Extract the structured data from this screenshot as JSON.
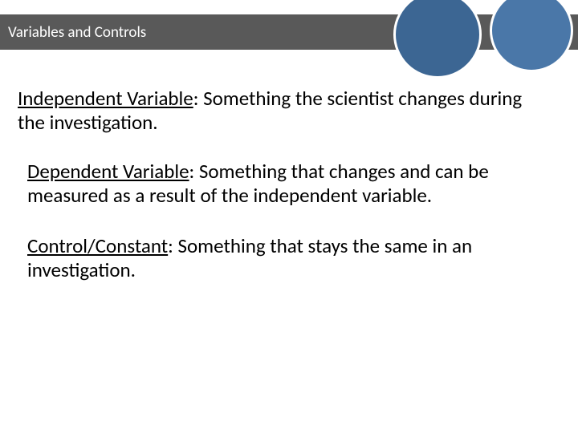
{
  "header": {
    "title": "Variables and Controls"
  },
  "definitions": [
    {
      "term": "Independent Variable",
      "text": ": Something the scientist changes during the investigation."
    },
    {
      "term": "Dependent Variable",
      "text": ": Something that changes and can be measured as a result of the independent variable."
    },
    {
      "term": "Control/Constant",
      "text": ": Something that stays the same in an investigation."
    }
  ],
  "colors": {
    "titleBar": "#595959",
    "circleLeft": "#3c6693",
    "circleRight": "#4a77a8",
    "text": "#000000",
    "titleText": "#ffffff"
  }
}
